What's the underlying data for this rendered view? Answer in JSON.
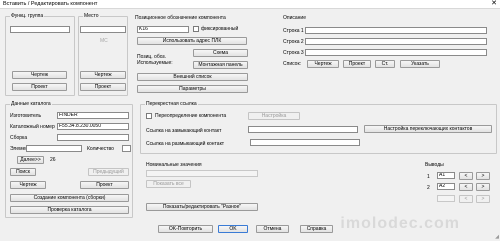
{
  "window": {
    "title": "Вставить / Редактировать компонент",
    "close_glyph": "✕"
  },
  "func_group": {
    "caption": "Функц. группа",
    "value": "",
    "drawing_label": "Чертеж",
    "project_label": "Проект"
  },
  "location": {
    "caption": "Место",
    "value": "",
    "disabled_value": "МС",
    "drawing_label": "Чертеж",
    "project_label": "Проект"
  },
  "component": {
    "caption": "Позиционное обозначение компонента",
    "tag_value": "K16",
    "fixed_label": "фиксированный",
    "use_plc_label": "Использовать адрес ПЛК",
    "schema_label": "Схема",
    "position_label": "Позиц. обоз.",
    "used_label": "Используемые:",
    "panel_label": "Монтажная панель",
    "external_list_label": "Внешний список",
    "params_label": "Параметры"
  },
  "description": {
    "caption": "Описание",
    "lines": [
      {
        "label": "Строка 1",
        "value": ""
      },
      {
        "label": "Строка 2",
        "value": ""
      },
      {
        "label": "Строка 3",
        "value": ""
      }
    ],
    "list_label": "Список:",
    "drawing_label": "Чертеж",
    "project_label": "Проект",
    "default_label": "Ст.",
    "pick_label": "Указать"
  },
  "catalog": {
    "caption": "Данные каталога",
    "manufacturer_label": "Изготовитель",
    "manufacturer_value": "FINDER",
    "catalog_label": "Каталожный номер",
    "catalog_value": "F55.34.8.230.0050",
    "assembly_label": "Сборка",
    "assembly_value": "",
    "item_label": "Элемент",
    "item_value": "",
    "qty_label": "Количество",
    "qty_value": "",
    "next_label": "Далее>>",
    "next_value": "26",
    "search_label": "Поиск",
    "previous_label": "Предыдущий",
    "drawing_label": "Чертеж",
    "project_label": "Проект",
    "create_label": "Создание компонента (сборки)",
    "check_label": "Проверка каталога"
  },
  "crossref": {
    "caption": "Перекрестная ссылка",
    "override_label": "Переопределение компонента",
    "settings_label": "Настройка",
    "no_label": "Ссылка на замыкающий контакт",
    "no_value": "",
    "nc_label": "Ссылка на размыкающий контакт",
    "nc_value": "",
    "switch_settings_label": "Настройка переключающих контактов"
  },
  "ratings": {
    "caption": "Номинальные значения",
    "value": "",
    "show_all_label": "Показать все",
    "show_edit_label": "Показать/редактировать \"Разное\""
  },
  "pins": {
    "caption": "Выводы",
    "rows": [
      {
        "num": "1",
        "value": "A1",
        "prev": "<",
        "next": ">"
      },
      {
        "num": "2",
        "value": "A2",
        "prev": "<",
        "next": ">"
      }
    ],
    "extra_prev": "<",
    "extra_next": ">"
  },
  "footer": {
    "ok_repeat_label": "OK-Повторить",
    "ok_label": "OK",
    "cancel_label": "Отмена",
    "help_label": "Справка"
  },
  "watermark": "imolodec.com"
}
